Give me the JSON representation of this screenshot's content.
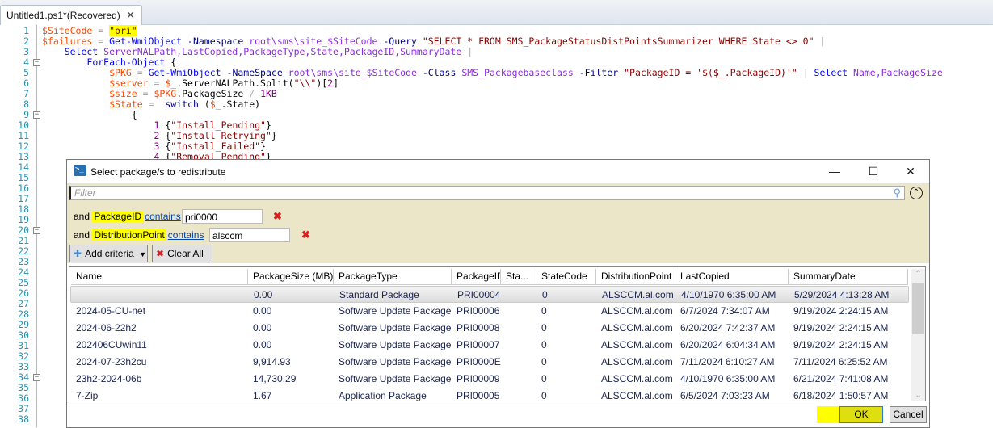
{
  "editor": {
    "tab_title": "Untitled1.ps1*(Recovered)",
    "tab_close": "✕",
    "line_count": 38,
    "fold_lines": [
      4,
      9,
      20,
      34
    ],
    "lines": [
      [
        [
          "$SiteCode",
          "var"
        ],
        [
          " = ",
          "op"
        ],
        [
          "\"pri\"",
          "str-hl"
        ]
      ],
      [
        [
          "$failures",
          "var"
        ],
        [
          " = ",
          "op"
        ],
        [
          "Get-WmiObject",
          "cmd"
        ],
        [
          " -Namespace",
          "param"
        ],
        [
          " root\\sms\\site_$SiteCode",
          "arg"
        ],
        [
          " -Query",
          "param"
        ],
        [
          " \"SELECT * FROM SMS_PackageStatusDistPointsSummarizer WHERE State <> 0\"",
          "str"
        ],
        [
          " |",
          "op"
        ]
      ],
      [
        [
          "    ",
          "mem"
        ],
        [
          "Select",
          "cmd"
        ],
        [
          " ServerNALPath,LastCopied,PackageType,State,PackageID,SummaryDate",
          "arg"
        ],
        [
          " |",
          "op"
        ]
      ],
      [
        [
          "        ",
          "mem"
        ],
        [
          "ForEach-Object",
          "cmd"
        ],
        [
          " {",
          "grp"
        ]
      ],
      [
        [
          "            ",
          "mem"
        ],
        [
          "$PKG",
          "var"
        ],
        [
          " = ",
          "op"
        ],
        [
          "Get-WmiObject",
          "cmd"
        ],
        [
          " -NameSpace",
          "param"
        ],
        [
          " root\\sms\\site_$SiteCode",
          "arg"
        ],
        [
          " -Class",
          "param"
        ],
        [
          " SMS_Packagebaseclass",
          "arg"
        ],
        [
          " -Filter",
          "param"
        ],
        [
          " \"PackageID = '$($_.PackageID)'\"",
          "str"
        ],
        [
          " |",
          "op"
        ],
        [
          " Select",
          "cmd"
        ],
        [
          " Name,PackageSize",
          "arg"
        ]
      ],
      [
        [
          "            ",
          "mem"
        ],
        [
          "$server",
          "var"
        ],
        [
          " = ",
          "op"
        ],
        [
          "$_",
          "var"
        ],
        [
          ".ServerNALPath.Split(",
          "mem"
        ],
        [
          "\"\\\\\"",
          "str"
        ],
        [
          ")[",
          "mem"
        ],
        [
          "2",
          "num"
        ],
        [
          "]",
          "mem"
        ]
      ],
      [
        [
          "            ",
          "mem"
        ],
        [
          "$size",
          "var"
        ],
        [
          " = ",
          "op"
        ],
        [
          "$PKG",
          "var"
        ],
        [
          ".PackageSize ",
          "mem"
        ],
        [
          "/ ",
          "op"
        ],
        [
          "1KB",
          "num"
        ]
      ],
      [
        [
          "            ",
          "mem"
        ],
        [
          "$State",
          "var"
        ],
        [
          " =  ",
          "op"
        ],
        [
          "switch",
          "kw"
        ],
        [
          " (",
          "grp"
        ],
        [
          "$_",
          "var"
        ],
        [
          ".State)",
          "mem"
        ]
      ],
      [
        [
          "                ",
          "mem"
        ],
        [
          "{",
          "grp"
        ]
      ],
      [
        [
          "                    ",
          "mem"
        ],
        [
          "1",
          "num"
        ],
        [
          " {",
          "grp"
        ],
        [
          "\"Install_Pending\"",
          "str"
        ],
        [
          "}",
          "grp"
        ]
      ],
      [
        [
          "                    ",
          "mem"
        ],
        [
          "2",
          "num"
        ],
        [
          " {",
          "grp"
        ],
        [
          "\"Install_Retrying\"",
          "str"
        ],
        [
          "}",
          "grp"
        ]
      ],
      [
        [
          "                    ",
          "mem"
        ],
        [
          "3",
          "num"
        ],
        [
          " {",
          "grp"
        ],
        [
          "\"Install_Failed\"",
          "str"
        ],
        [
          "}",
          "grp"
        ]
      ],
      [
        [
          "                    ",
          "mem"
        ],
        [
          "4",
          "num"
        ],
        [
          " {",
          "grp"
        ],
        [
          "\"Removal_Pending\"",
          "str"
        ],
        [
          "}",
          "grp"
        ]
      ]
    ]
  },
  "dialog": {
    "icon": ">_",
    "title": "Select package/s to redistribute",
    "minimize": "—",
    "maximize": "☐",
    "close": "✕",
    "filter_placeholder": "Filter",
    "search_icon": "⚲",
    "collapse_icon": "⌃",
    "criteria": [
      {
        "prefix": "and",
        "field": "PackageID",
        "op": "contains",
        "value": "pri0000",
        "remove": "✖"
      },
      {
        "prefix": "and",
        "field": "DistributionPoint",
        "op": "contains",
        "value": "alsccm",
        "remove": "✖"
      }
    ],
    "add_criteria": "Add criteria",
    "add_icon": "✚",
    "dropdown_icon": "▼",
    "clear_all": "Clear All",
    "clear_icon": "✖",
    "columns": [
      "Name",
      "PackageSize (MB)",
      "PackageType",
      "PackageID",
      "Sta...",
      "StateCode",
      "DistributionPoint",
      "LastCopied",
      "SummaryDate"
    ],
    "rows": [
      [
        "",
        "0.00",
        "Standard Package",
        "PRI00004",
        "",
        "0",
        "ALSCCM.al.com",
        "4/10/1970 6:35:00 AM",
        "5/29/2024 4:13:28 AM"
      ],
      [
        "2024-05-CU-net",
        "0.00",
        "Software Update Package",
        "PRI00006",
        "",
        "0",
        "ALSCCM.al.com",
        "6/7/2024 7:34:07 AM",
        "9/19/2024 2:24:15 AM"
      ],
      [
        "2024-06-22h2",
        "0.00",
        "Software Update Package",
        "PRI00008",
        "",
        "0",
        "ALSCCM.al.com",
        "6/20/2024 7:42:37 AM",
        "9/19/2024 2:24:15 AM"
      ],
      [
        "202406CUwin11",
        "0.00",
        "Software Update Package",
        "PRI00007",
        "",
        "0",
        "ALSCCM.al.com",
        "6/20/2024 6:04:34 AM",
        "9/19/2024 2:24:15 AM"
      ],
      [
        "2024-07-23h2cu",
        "9,914.93",
        "Software Update Package",
        "PRI0000E",
        "",
        "0",
        "ALSCCM.al.com",
        "7/11/2024 6:10:27 AM",
        "7/11/2024 6:25:52 AM"
      ],
      [
        "23h2-2024-06b",
        "14,730.29",
        "Software Update Package",
        "PRI00009",
        "",
        "0",
        "ALSCCM.al.com",
        "4/10/1970 6:35:00 AM",
        "6/21/2024 7:41:08 AM"
      ],
      [
        "7-Zip",
        "1.67",
        "Application Package",
        "PRI00005",
        "",
        "0",
        "ALSCCM.al.com",
        "6/5/2024 7:03:23 AM",
        "6/18/2024 1:50:57 AM"
      ]
    ],
    "scroll_up": "⌃",
    "scroll_down": "⌄",
    "ok": "OK",
    "cancel": "Cancel"
  }
}
